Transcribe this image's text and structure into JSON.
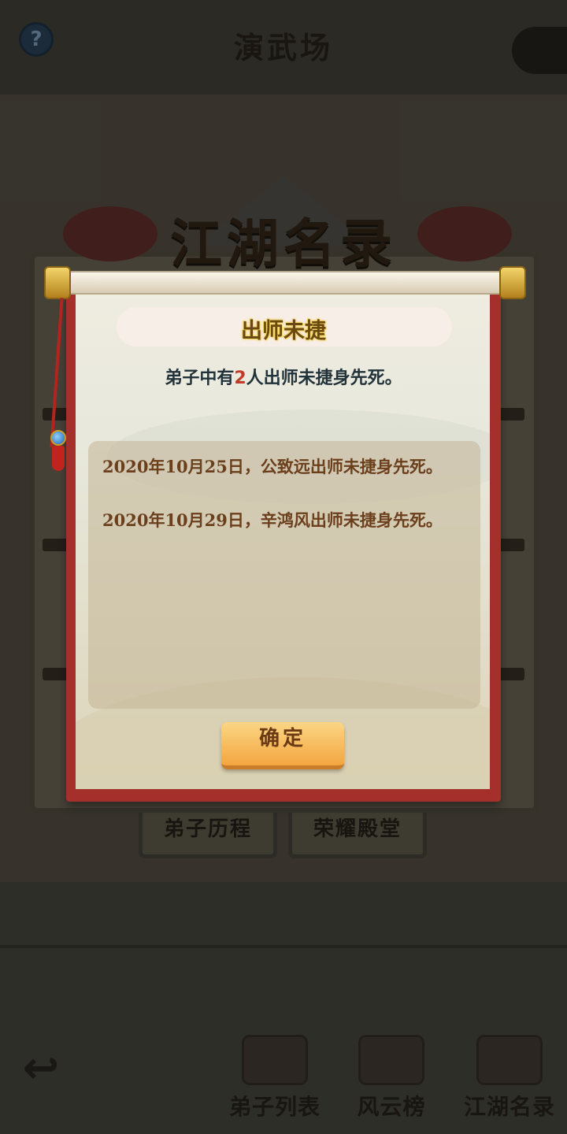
{
  "header": {
    "title": "演武场",
    "help_icon": "question-mark-icon",
    "help_glyph": "?"
  },
  "panel": {
    "banner": "江湖名录",
    "tabs": [
      {
        "label": "弟子历程"
      },
      {
        "label": "荣耀殿堂"
      }
    ]
  },
  "dialog": {
    "title": "出师未捷",
    "summary_prefix": "弟子中有",
    "summary_count": "2",
    "summary_suffix": "人出师未捷身先死。",
    "records": [
      "2020年10月25日，公致远出师未捷身先死。",
      "2020年10月29日，辛鸿风出师未捷身先死。"
    ],
    "confirm_label": "确定"
  },
  "bottom_nav": {
    "back_icon": "back-arrow-icon",
    "back_glyph": "↩",
    "items": [
      {
        "label": "弟子列表",
        "icon": "disciple-avatar-icon"
      },
      {
        "label": "风云榜",
        "icon": "scroll-board-icon"
      },
      {
        "label": "江湖名录",
        "icon": "book-icon"
      }
    ]
  },
  "colors": {
    "scroll_border": "#a52f2b",
    "paper": "#e8e8dc",
    "count_highlight": "#c23a2a",
    "record_text": "#6b3f1c",
    "button": "#f3a640"
  }
}
